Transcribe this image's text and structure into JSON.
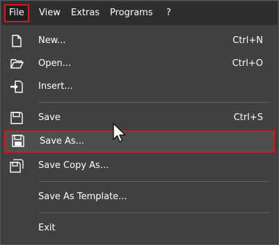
{
  "menubar": {
    "items": [
      {
        "label": "File",
        "active": true
      },
      {
        "label": "View"
      },
      {
        "label": "Extras"
      },
      {
        "label": "Programs"
      },
      {
        "label": "?"
      }
    ]
  },
  "file_menu": {
    "items": [
      {
        "label": "New...",
        "shortcut": "Ctrl+N",
        "icon": "new-document-icon"
      },
      {
        "label": "Open...",
        "shortcut": "Ctrl+O",
        "icon": "open-folder-icon"
      },
      {
        "label": "Insert...",
        "shortcut": "",
        "icon": "insert-icon"
      },
      {
        "label": "Save",
        "shortcut": "Ctrl+S",
        "icon": "save-icon"
      },
      {
        "label": "Save As...",
        "shortcut": "",
        "icon": "save-as-icon",
        "highlighted": true
      },
      {
        "label": "Save Copy As...",
        "shortcut": "",
        "icon": "save-copy-icon"
      },
      {
        "label": "Save As Template...",
        "shortcut": ""
      },
      {
        "label": "Exit",
        "shortcut": ""
      }
    ]
  },
  "colors": {
    "highlight_border": "#e0141b",
    "menu_background": "#404040",
    "menubar_background": "#2e2e2e",
    "text": "#ffffff"
  }
}
